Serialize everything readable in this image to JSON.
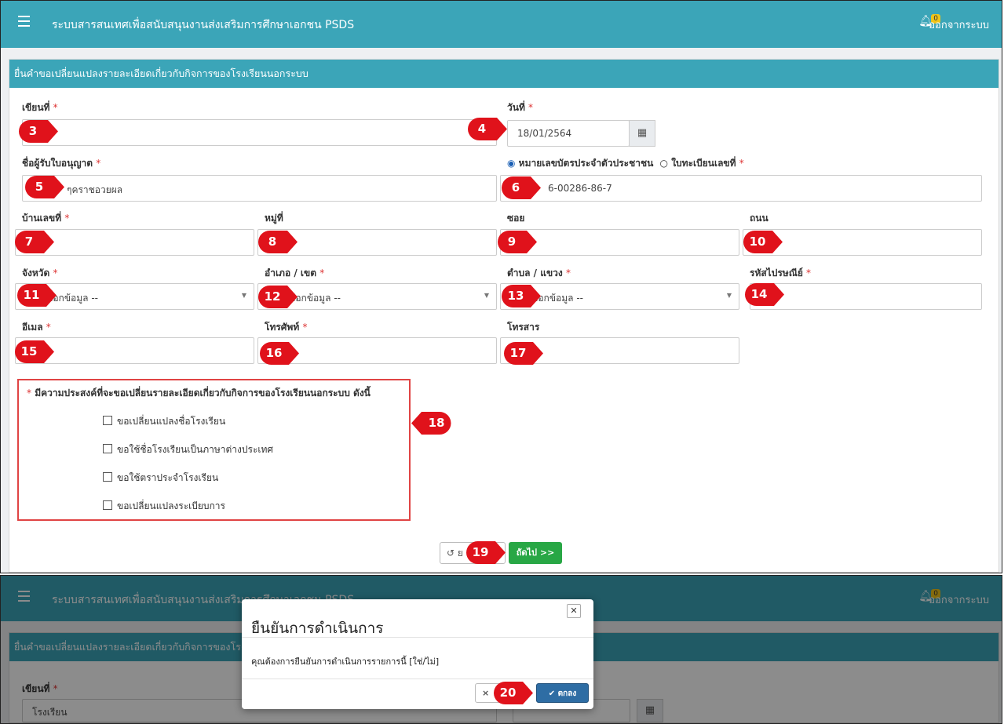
{
  "navbar": {
    "title": "ระบบสารสนเทศเพื่อสนับสนุนงานส่งเสริมการศึกษาเอกชน PSDS",
    "notif_count": "0",
    "logout": "ออกจากระบบ"
  },
  "form": {
    "header": "ยื่นคำขอเปลี่ยนแปลงรายละเอียดเกี่ยวกับกิจการของโรงเรียนนอกระบบ",
    "required_mark": "*",
    "labels": {
      "written_at": "เขียนที่",
      "date": "วันที่",
      "licensee_name": "ชื่อผู้รับใบอนุญาต",
      "house_no": "บ้านเลขที่",
      "moo": "หมู่ที่",
      "soi": "ซอย",
      "road": "ถนน",
      "province": "จังหวัด",
      "district": "อำเภอ / เขต",
      "subdistrict": "ตำบล / แขวง",
      "postcode": "รหัสไปรษณีย์",
      "email": "อีเมล",
      "phone": "โทรศัพท์",
      "fax": "โทรสาร"
    },
    "values": {
      "date": "18/01/2564",
      "licensee_name": "ๆคราชอวยผล",
      "id_number": "6-00286-86-7"
    },
    "radio_id_card": "หมายเลขบัตรประจำตัวประชาชน",
    "radio_registration": "ใบทะเบียนเลขที่",
    "select_placeholder": "ลือกข้อมูล --",
    "purpose_title": "มีความประสงค์ที่จะขอเปลี่ยนรายละเอียดเกี่ยวกับกิจการของโรงเรียนนอกระบบ ดังนี้",
    "checkboxes": [
      "ขอเปลี่ยนแปลงชื่อโรงเรียน",
      "ขอใช้ชื่อโรงเรียนเป็นภาษาต่างประเทศ",
      "ขอใช้ตราประจำโรงเรียน",
      "ขอเปลี่ยนแปลงระเบียบการ"
    ],
    "reset_label": "ย",
    "next_label": "ถัดไป >>"
  },
  "markers": [
    "3",
    "4",
    "5",
    "6",
    "7",
    "8",
    "9",
    "10",
    "11",
    "12",
    "13",
    "14",
    "15",
    "16",
    "17",
    "18",
    "19",
    "20"
  ],
  "modal": {
    "title": "ยืนยันการดำเนินการ",
    "body": "คุณต้องการยืนยันการดำเนินการรายการนี้ [ใช่/ไม่]",
    "ok": "ตกลง",
    "cancel": "×"
  },
  "bg2": {
    "written_at_value": "โรงเรียน"
  },
  "colors": {
    "navbar": "#3ba5b8",
    "marker": "#e0121b",
    "next_button": "#28a745",
    "ok_button": "#2e6da4",
    "highlight_box": "#e04444"
  }
}
